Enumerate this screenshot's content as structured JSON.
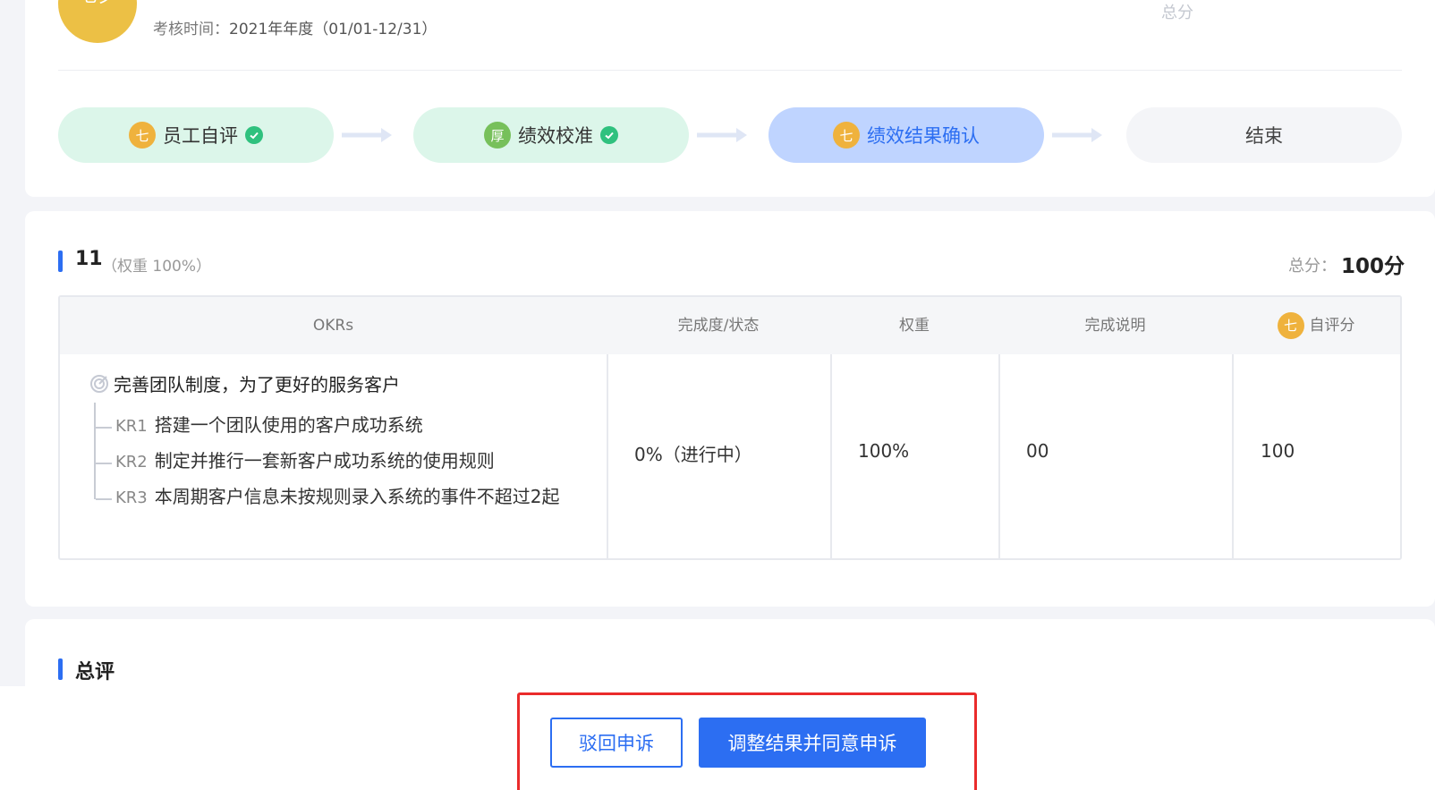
{
  "header": {
    "avatar_text": "七夕",
    "period_label": "考核时间：",
    "period_value": "2021年年度（01/01-12/31）",
    "total_label": "总分"
  },
  "steps": [
    {
      "badge": "七",
      "label": "员工自评",
      "status": "done",
      "badge_color": "#efb23d"
    },
    {
      "badge": "厚",
      "label": "绩效校准",
      "status": "done",
      "badge_color": "#77c05b"
    },
    {
      "badge": "七",
      "label": "绩效结果确认",
      "status": "active",
      "badge_color": "#efb23d"
    },
    {
      "badge": "",
      "label": "结束",
      "status": "todo"
    }
  ],
  "okr_section": {
    "title": "11",
    "weight": "（权重 100%）",
    "total_label": "总分：",
    "total_value": "100分",
    "columns": [
      "OKRs",
      "完成度/状态",
      "权重",
      "完成说明",
      "自评分"
    ],
    "self_score_badge": "七",
    "rows": [
      {
        "objective": "完善团队制度，为了更好的服务客户",
        "key_results": [
          {
            "code": "KR1",
            "text": "搭建一个团队使用的客户成功系统"
          },
          {
            "code": "KR2",
            "text": "制定并推行一套新客户成功系统的使用规则"
          },
          {
            "code": "KR3",
            "text": "本周期客户信息未按规则录入系统的事件不超过2起"
          }
        ],
        "completion": "0%（进行中）",
        "weight": "100%",
        "description": "00",
        "self_score": "100"
      }
    ]
  },
  "summary_section": {
    "title": "总评"
  },
  "actions": {
    "reject_label": "驳回申诉",
    "adjust_label": "调整结果并同意申诉"
  },
  "colors": {
    "primary": "#2c6ef2",
    "done_bg": "#dcf6ea",
    "active_bg": "#bfd4ff",
    "check": "#2fc17e",
    "highlight_box": "#ea2b2b"
  }
}
